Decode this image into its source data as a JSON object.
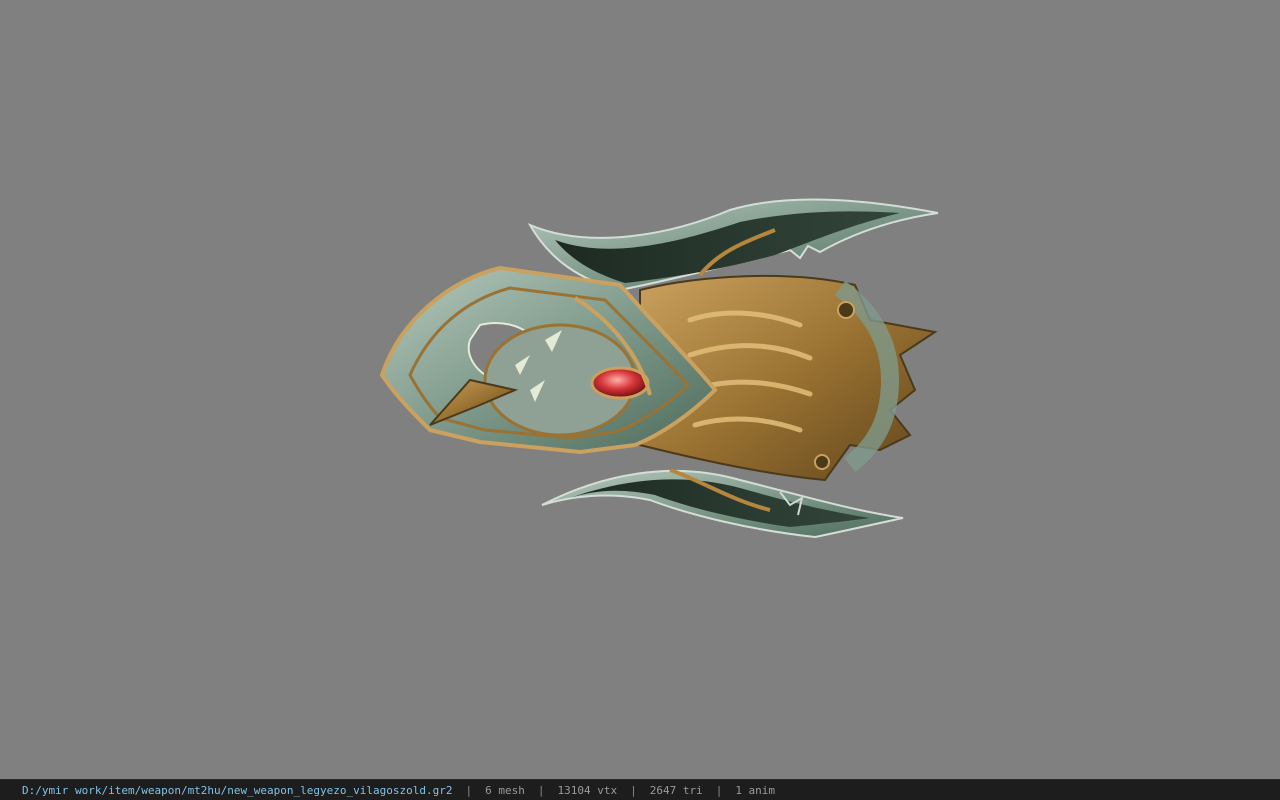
{
  "viewport": {
    "background_color": "#808080",
    "model_name": "3d-weapon-model"
  },
  "status_bar": {
    "file_path": "D:/ymir work/item/weapon/mt2hu/new_weapon_legyezo_vilagoszold.gr2",
    "separator": "|",
    "mesh": "6 mesh",
    "vtx": "13104 vtx",
    "tri": "2647 tri",
    "anim": "1 anim",
    "path_color": "#7fc4e6"
  }
}
